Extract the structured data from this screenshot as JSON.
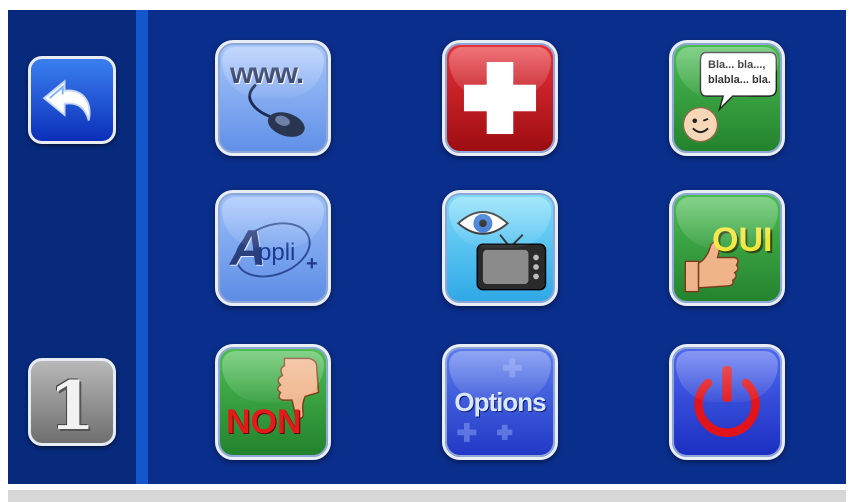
{
  "sidebar": {
    "back_icon": "back-arrow-icon",
    "page_number": "1"
  },
  "tiles": {
    "internet": {
      "label": "www.",
      "icon": "mouse-icon"
    },
    "emergency": {
      "icon": "red-cross-icon"
    },
    "chat": {
      "bubble_line1": "Bla... bla...,",
      "bubble_line2": "blabla... bla.",
      "icon": "smiley-icon"
    },
    "apps": {
      "label_a": "A",
      "label_rest": "ppli",
      "plus": "+"
    },
    "tv": {
      "icon": "eye-tv-icon"
    },
    "yes": {
      "label": "OUI",
      "icon": "thumbs-up-icon"
    },
    "no": {
      "label": "NON",
      "icon": "thumbs-down-icon"
    },
    "options": {
      "label": "Options"
    },
    "power": {
      "icon": "power-icon"
    }
  },
  "colors": {
    "background": "#0a2e8c",
    "sidebar": "#072a7c",
    "divider": "#1456cc",
    "light_blue_tile": "#7fa8ee",
    "red_tile": "#c4141a",
    "green_tile": "#2f9a3c",
    "cyan_tile": "#45c6f0",
    "dark_blue_tile": "#1c3fd0"
  }
}
